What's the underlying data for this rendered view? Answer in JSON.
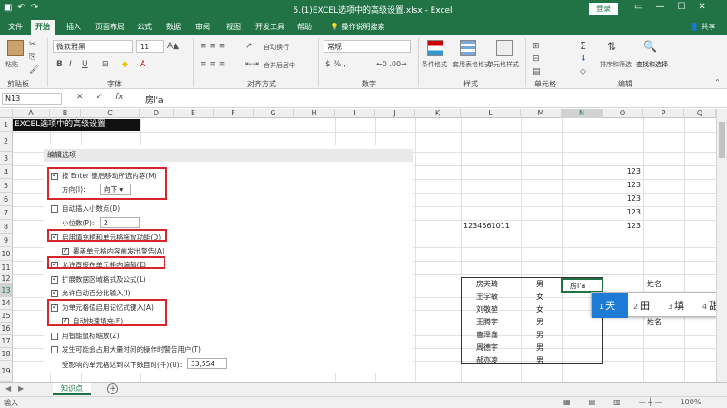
{
  "window": {
    "title": "5.(1)EXCEL选项中的高级设置.xlsx - Excel",
    "login": "登录",
    "share": "共享"
  },
  "tabs": [
    "文件",
    "开始",
    "插入",
    "页面布局",
    "公式",
    "数据",
    "审阅",
    "视图",
    "开发工具",
    "帮助",
    "操作说明搜索"
  ],
  "ribbon": {
    "font_name": "微软雅黑",
    "font_size": "11",
    "number_format": "常规",
    "wrap": "自动换行",
    "merge": "合并后居中",
    "cond_format": "条件格式",
    "table_format": "套用表格格式",
    "cell_style": "单元格样式",
    "sort_filter": "排序和筛选",
    "find_select": "查找和选择",
    "paste": "粘贴",
    "groups": [
      "剪贴板",
      "字体",
      "对齐方式",
      "数字",
      "样式",
      "单元格",
      "编辑"
    ]
  },
  "formula_bar": {
    "namebox": "N13",
    "content": "房l'a"
  },
  "columns": [
    "A",
    "B",
    "C",
    "D",
    "E",
    "F",
    "G",
    "H",
    "I",
    "J",
    "K",
    "L",
    "M",
    "N",
    "O",
    "P",
    "Q"
  ],
  "rows": [
    "1",
    "2",
    "3",
    "4",
    "5",
    "6",
    "7",
    "8",
    "9",
    "10",
    "11",
    "12",
    "13",
    "14",
    "15",
    "16",
    "17",
    "18",
    "19"
  ],
  "sheet": {
    "a1": "EXCEL选项中的高级设置",
    "section": "编辑选项",
    "options": [
      {
        "label": "按 Enter 键后移动所选内容(M)",
        "checked": true
      },
      {
        "label": "方向(I):",
        "checked": null
      },
      {
        "label": "自动插入小数点(D)",
        "checked": false
      },
      {
        "label": "小位数(P):",
        "checked": null
      },
      {
        "label": "启用填充柄和单元格拖放功能(D)",
        "checked": true
      },
      {
        "label": "覆盖单元格内容前发出警告(A)",
        "checked": true
      },
      {
        "label": "允许直接在单元格内编辑(E)",
        "checked": true
      },
      {
        "label": "扩展数据区域格式及公式(L)",
        "checked": true
      },
      {
        "label": "允许自动百分比输入(I)",
        "checked": true
      },
      {
        "label": "为单元格值启用记忆式键入(A)",
        "checked": true
      },
      {
        "label": "自动快速填充(F)",
        "checked": true
      },
      {
        "label": "用智能鼠标缩放(Z)",
        "checked": false
      },
      {
        "label": "发生可能会占用大量时间的操作时警告用户(T)",
        "checked": false
      },
      {
        "label": "受影响的单元格达到以下数目时(千)(U):",
        "checked": null
      }
    ],
    "direction_value": "向下",
    "decimal_value": "2",
    "cells_value": "33,554",
    "o_values": [
      "123",
      "123",
      "123",
      "123",
      "123"
    ],
    "l8": "1234561011",
    "names": [
      "房天琦",
      "王学敏",
      "刘敬堃",
      "王腾宇",
      "曹泽鑫",
      "周德宇",
      "郝亦凌"
    ],
    "genders": [
      "男",
      "女",
      "女",
      "男",
      "男",
      "男",
      "男"
    ],
    "n13": "房l'a",
    "p13": "姓名",
    "p16": "姓名"
  },
  "ime": {
    "candidates": [
      {
        "num": "1",
        "text": "天"
      },
      {
        "num": "2",
        "text": "田"
      },
      {
        "num": "3",
        "text": "填"
      },
      {
        "num": "4",
        "text": "甜"
      }
    ]
  },
  "sheet_tab": "知识点",
  "status": {
    "mode": "输入",
    "zoom": "100%"
  }
}
